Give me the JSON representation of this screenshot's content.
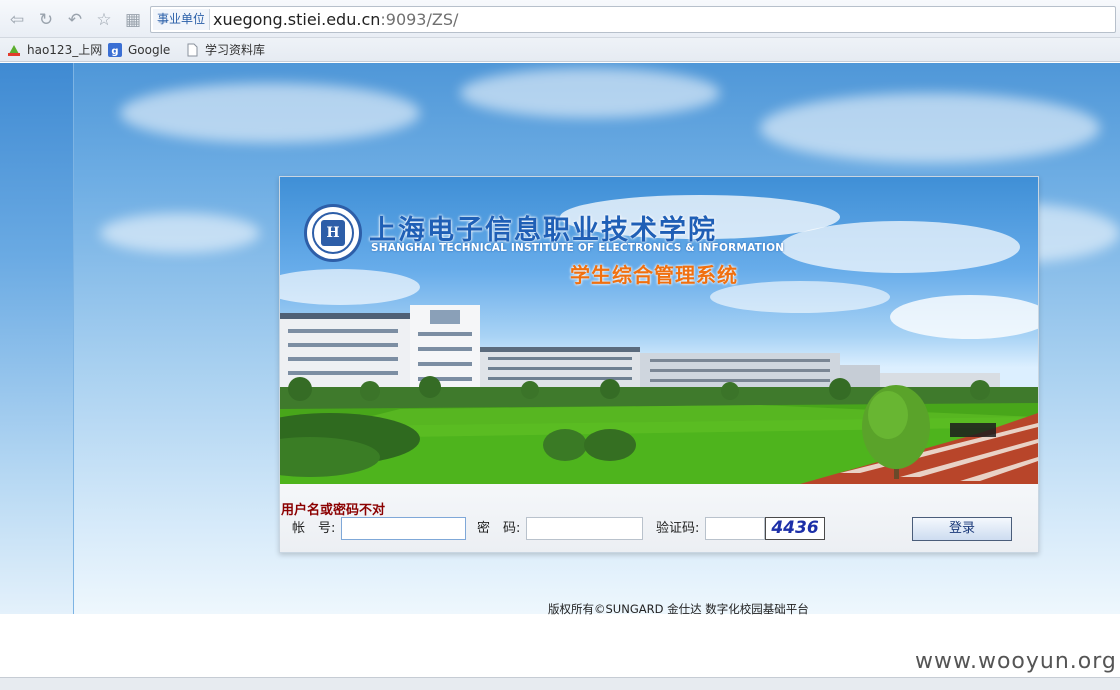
{
  "browser": {
    "site_badge": "事业单位",
    "url_host": "xuegong.stiei.edu.cn",
    "url_rest": ":9093/ZS/",
    "bookmarks": [
      {
        "label": "hao123_上网",
        "icon": "hao123-icon"
      },
      {
        "label": "Google",
        "icon": "google-icon"
      },
      {
        "label": "学习资料库",
        "icon": "page-icon"
      }
    ]
  },
  "banner": {
    "school_cn": "上海电子信息职业技术学院",
    "school_en": "SHANGHAI TECHNICAL INSTITUTE OF ELECTRONICS & INFORMATION",
    "system_title": "学生综合管理系统"
  },
  "login": {
    "error": "用户名或密码不对",
    "account_label": "帐　号:",
    "account_value": "",
    "password_label": "密　码:",
    "password_value": "",
    "captcha_label": "验证码:",
    "captcha_value": "",
    "captcha_code": "4436",
    "submit": "登录"
  },
  "footer": {
    "copyright": "版权所有©SUNGARD 金仕达 数字化校园基础平台"
  },
  "watermark": "www.wooyun.org",
  "colors": {
    "sky": "#6faee4",
    "error": "#8b0000",
    "title_blue": "#1f5fb6",
    "title_orange": "#f07010"
  }
}
